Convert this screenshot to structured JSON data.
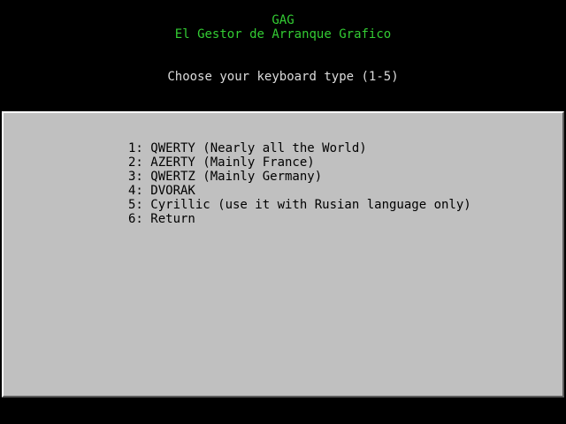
{
  "header": {
    "title": "GAG",
    "subtitle": "El Gestor de Arranque Grafico",
    "prompt": "Choose your keyboard type (1-5)"
  },
  "menu": {
    "items": [
      {
        "text": "1: QWERTY (Nearly all the World)"
      },
      {
        "text": "2: AZERTY (Mainly France)"
      },
      {
        "text": "3: QWERTZ (Mainly Germany)"
      },
      {
        "text": "4: DVORAK"
      },
      {
        "text": "5: Cyrillic (use it with Rusian language only)"
      },
      {
        "text": "6: Return"
      }
    ]
  },
  "colors": {
    "background": "#000000",
    "title": "#33cc33",
    "prompt": "#dcdcdc",
    "panel": "#c0c0c0",
    "menu_text": "#000000"
  }
}
